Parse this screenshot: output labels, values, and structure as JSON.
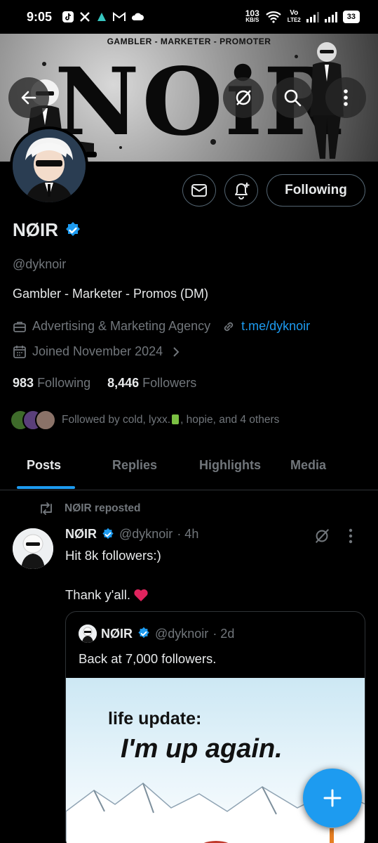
{
  "status_bar": {
    "time": "9:05",
    "speed_value": "103",
    "speed_unit": "KB/S",
    "volte_line1": "Vo",
    "volte_line2": "LTE2",
    "battery": "33",
    "app_icons": [
      "tiktok-icon",
      "x-icon",
      "app-icon",
      "gmail-icon",
      "cloud-icon"
    ]
  },
  "banner": {
    "tagline": "GAMBLER - MARKETER - PROMOTER",
    "big_text": "NOiR"
  },
  "header_buttons": [
    "back-arrow-icon",
    "grok-icon",
    "search-icon",
    "more-vertical-icon"
  ],
  "profile": {
    "display_name": "NØIR",
    "handle": "@dyknoir",
    "bio": "Gambler - Marketer - Promos (DM)",
    "category": "Advertising & Marketing Agency",
    "link": "t.me/dyknoir",
    "joined": "Joined November 2024",
    "following_count": "983",
    "following_label": "Following",
    "followers_count": "8,446",
    "followers_label": "Followers",
    "followed_by_prefix": "Followed by cold, lyxx.",
    "followed_by_suffix": ", hopie, and 4 others",
    "verified": true
  },
  "actions": {
    "following_button": "Following"
  },
  "tabs": [
    {
      "label": "Posts",
      "active": true
    },
    {
      "label": "Replies",
      "active": false
    },
    {
      "label": "Highlights",
      "active": false
    },
    {
      "label": "Media",
      "active": false
    }
  ],
  "post": {
    "repost_label": "NØIR reposted",
    "author": "NØIR",
    "handle": "@dyknoir",
    "time": "· 4h",
    "text_line1": "Hit 8k followers:)",
    "text_line2": "Thank y'all.",
    "quote": {
      "author": "NØIR",
      "handle": "@dyknoir",
      "time": "· 2d",
      "text": "Back at 7,000 followers.",
      "image_line1": "life update:",
      "image_line2": "I'm up again."
    }
  },
  "colors": {
    "accent": "#1d9bf0",
    "background": "#000000",
    "text_primary": "#e7e9ea",
    "text_secondary": "#71767b",
    "border": "#2f3336"
  }
}
